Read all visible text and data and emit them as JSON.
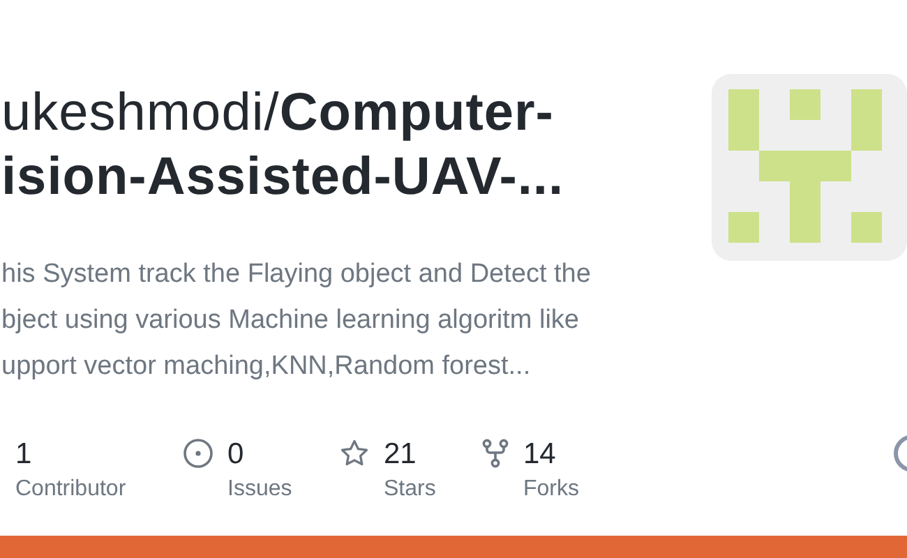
{
  "repo": {
    "owner": "ukeshmodi/",
    "name_line_1": "Computer-",
    "name_line_2": "ision-Assisted-UAV-..."
  },
  "description": [
    "his System track the Flaying object and Detect the",
    "bject using various Machine learning algoritm like",
    "upport vector maching,KNN,Random forest..."
  ],
  "stats": [
    {
      "kind": "contributors",
      "value": "1",
      "label": "Contributor"
    },
    {
      "kind": "issues",
      "value": "0",
      "label": "Issues"
    },
    {
      "kind": "stars",
      "value": "21",
      "label": "Stars"
    },
    {
      "kind": "forks",
      "value": "14",
      "label": "Forks"
    }
  ]
}
